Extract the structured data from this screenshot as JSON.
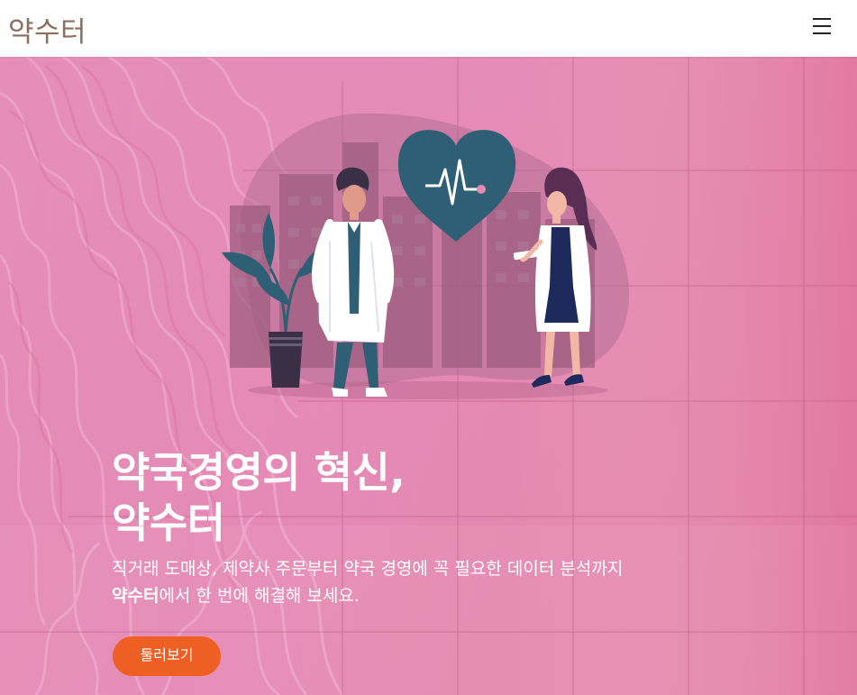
{
  "header": {
    "brand": "약수터",
    "menu_icon": "hamburger-menu-icon"
  },
  "hero": {
    "title_line1": "약국경영의 혁신,",
    "title_line2": "약수터",
    "subtitle_line1": "직거래 도매상, 제약사 주문부터 약국 경영에 꼭 필요한 데이터 분석까지",
    "subtitle_brand": "약수터",
    "subtitle_line2_rest": "에서 한 번에 해결해 보세요.",
    "cta_label": "둘러보기",
    "illustration": "doctors-heart-illustration"
  },
  "colors": {
    "hero_background": "#e486b3",
    "cta_background": "#ef5f24",
    "brand_text": "#8a6e5e",
    "illustration_teal": "#2f5f75"
  }
}
